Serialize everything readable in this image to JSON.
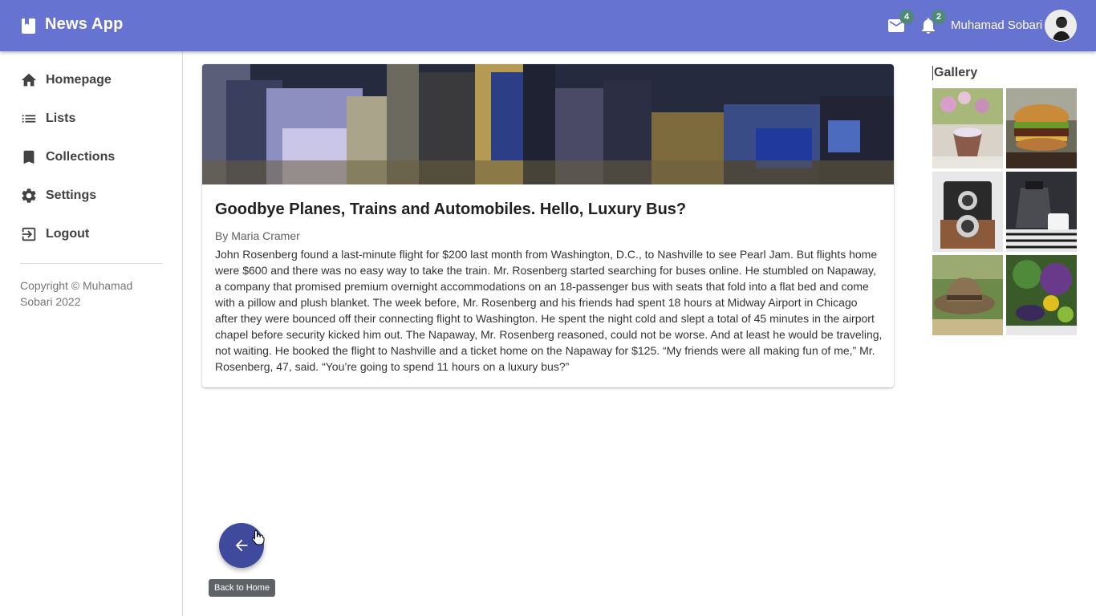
{
  "app": {
    "title": "News App"
  },
  "header": {
    "mail_count": "4",
    "notification_count": "2",
    "user_name": "Muhamad Sobari"
  },
  "sidebar": {
    "items": [
      {
        "label": "Homepage",
        "icon": "home-icon"
      },
      {
        "label": "Lists",
        "icon": "list-icon"
      },
      {
        "label": "Collections",
        "icon": "bookmark-icon"
      },
      {
        "label": "Settings",
        "icon": "gear-icon"
      },
      {
        "label": "Logout",
        "icon": "logout-icon"
      }
    ],
    "copyright": "Copyright © Muhamad Sobari 2022"
  },
  "article": {
    "title": "Goodbye Planes, Trains and Automobiles. Hello, Luxury Bus?",
    "author": "By Maria Cramer",
    "body": "John Rosenberg found a last-minute flight for $200 last month from Washington, D.C., to Nashville to see Pearl Jam. But flights home were $600 and there was no easy way to take the train. Mr. Rosenberg started searching for buses online. He stumbled on Napaway, a company that promised premium overnight accommodations on an 18-passenger bus with seats that fold into a flat bed and come with a pillow and plush blanket. The week before, Mr. Rosenberg and his friends had spent 18 hours at Midway Airport in Chicago after they were bounced off their connecting flight to Washington. He spent the night cold and slept a total of 45 minutes in the airport chapel before security kicked him out. The Napaway, Mr. Rosenberg reasoned, could not be worse. And at least he would be traveling, not waiting. He booked the flight to Nashville and a ticket home on the Napaway for $125. “My friends were all making fun of me,” Mr. Rosenberg, 47, said. “You’re going to spend 11 hours on a luxury bus?”"
  },
  "gallery": {
    "title": "Gallery",
    "images": [
      "dessert-photo",
      "burger-photo",
      "camera-photo",
      "kettle-photo",
      "hat-photo",
      "vegetables-photo"
    ]
  },
  "fab": {
    "tooltip": "Back to Home",
    "icon": "arrow-left-icon"
  },
  "colors": {
    "appbar": "#6673d0",
    "fab": "#3f4a9c",
    "badge": "#4f8a76"
  }
}
